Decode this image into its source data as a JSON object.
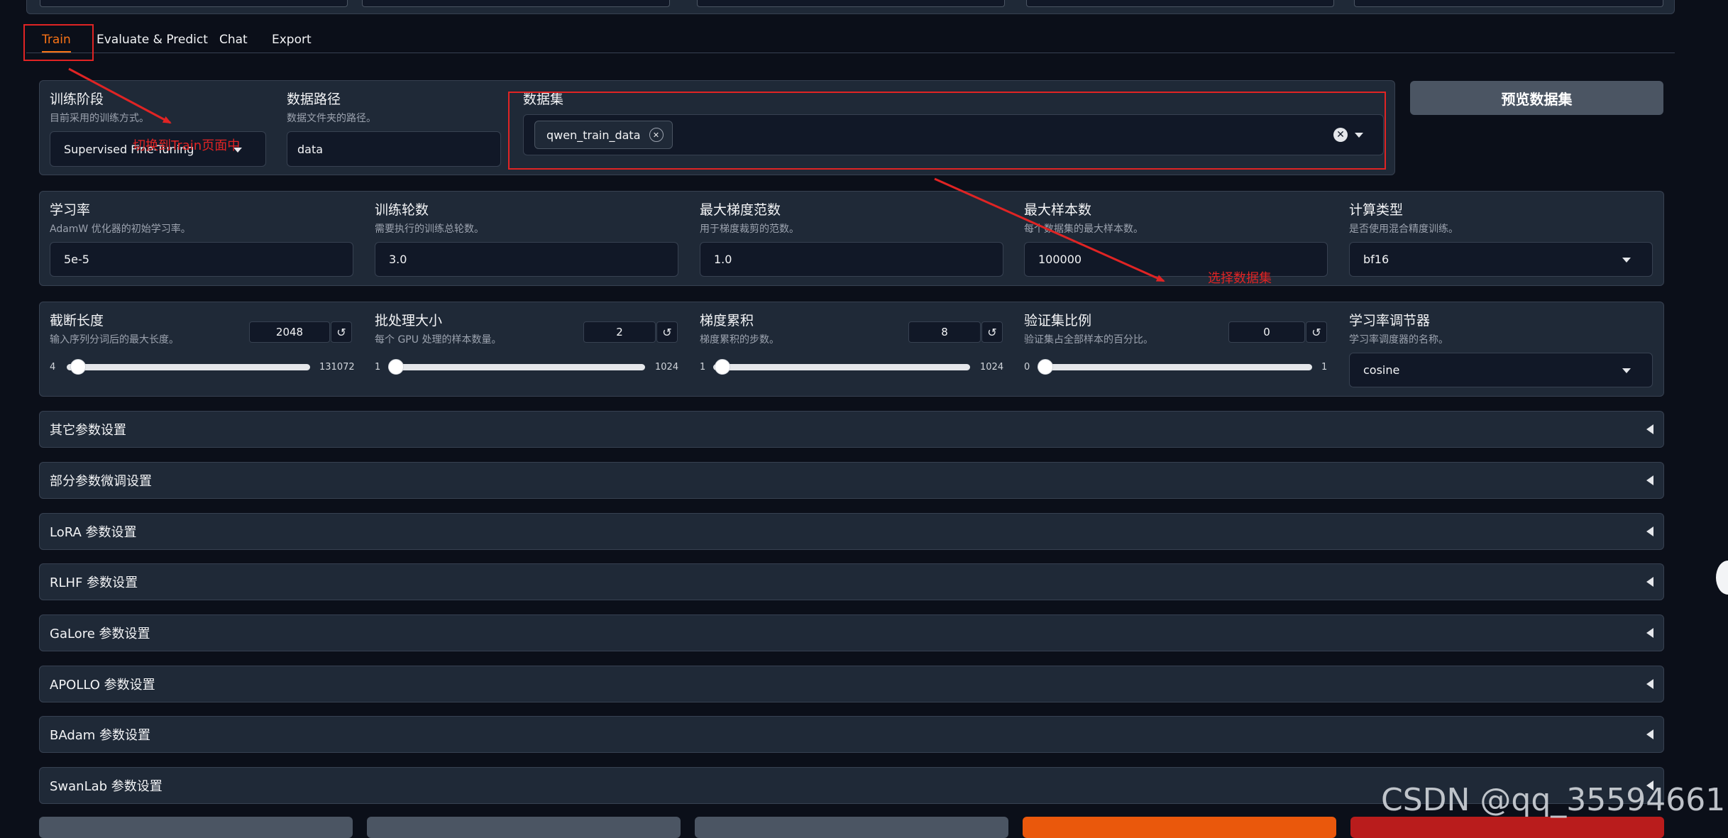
{
  "tabs": [
    "Train",
    "Evaluate & Predict",
    "Chat",
    "Export"
  ],
  "row1": {
    "stage": {
      "label": "训练阶段",
      "info": "目前采用的训练方式。",
      "value": "Supervised Fine-Tuning"
    },
    "dataset_dir": {
      "label": "数据路径",
      "info": "数据文件夹的路径。",
      "value": "data"
    },
    "dataset": {
      "label": "数据集",
      "chip": "qwen_train_data"
    },
    "preview_button": "预览数据集"
  },
  "row2": {
    "lr": {
      "label": "学习率",
      "info": "AdamW 优化器的初始学习率。",
      "value": "5e-5"
    },
    "epochs": {
      "label": "训练轮数",
      "info": "需要执行的训练总轮数。",
      "value": "3.0"
    },
    "max_grad_norm": {
      "label": "最大梯度范数",
      "info": "用于梯度裁剪的范数。",
      "value": "1.0"
    },
    "max_samples": {
      "label": "最大样本数",
      "info": "每个数据集的最大样本数。",
      "value": "100000"
    },
    "compute_type": {
      "label": "计算类型",
      "info": "是否使用混合精度训练。",
      "value": "bf16"
    }
  },
  "row3": {
    "cutoff_len": {
      "label": "截断长度",
      "info": "输入序列分词后的最大长度。",
      "value": "2048",
      "min": "4",
      "max": "131072",
      "level": 0.015
    },
    "batch_size": {
      "label": "批处理大小",
      "info": "每个 GPU 处理的样本数量。",
      "value": "2",
      "min": "1",
      "max": "1024",
      "level": 0.001
    },
    "grad_accum": {
      "label": "梯度累积",
      "info": "梯度累积的步数。",
      "value": "8",
      "min": "1",
      "max": "1024",
      "level": 0.007
    },
    "val_size": {
      "label": "验证集比例",
      "info": "验证集占全部样本的百分比。",
      "value": "0",
      "min": "0",
      "max": "1",
      "level": 0.0
    },
    "lr_scheduler": {
      "label": "学习率调节器",
      "info": "学习率调度器的名称。",
      "value": "cosine"
    }
  },
  "accordions": [
    "其它参数设置",
    "部分参数微调设置",
    "LoRA 参数设置",
    "RLHF 参数设置",
    "GaLore 参数设置",
    "APOLLO 参数设置",
    "BAdam 参数设置",
    "SwanLab 参数设置"
  ],
  "annotations": {
    "tab_note": "切换到Train页面中",
    "dataset_note": "选择数据集"
  },
  "watermark": "CSDN @qq_35594661",
  "colors": {
    "accent": "#f97316",
    "annotation": "#e02424",
    "start_button": "#ea580c",
    "abort_button": "#b91c1c"
  }
}
